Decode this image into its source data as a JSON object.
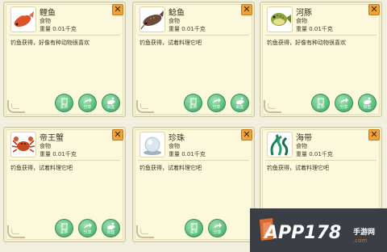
{
  "cards": [
    {
      "name": "鲤鱼",
      "type": "食物",
      "weight": "重量 0.01千克",
      "desc": "钓鱼获得，好像有种动物很喜欢",
      "icon": "carp-icon",
      "buttons": [
        "丢弃",
        "分享",
        "出售"
      ]
    },
    {
      "name": "鲶鱼",
      "type": "食物",
      "weight": "重量 0.01千克",
      "desc": "钓鱼获得，试着料理它吧",
      "icon": "catfish-icon",
      "buttons": [
        "丢弃",
        "分享",
        "出售"
      ]
    },
    {
      "name": "河豚",
      "type": "食物",
      "weight": "重量 0.01千克",
      "desc": "钓鱼获得，好像有种动物很喜欢",
      "icon": "pufferfish-icon",
      "buttons": [
        "丢弃",
        "分享",
        "出售"
      ]
    },
    {
      "name": "帝王蟹",
      "type": "食物",
      "weight": "重量 0.01千克",
      "desc": "钓鱼获得，试着料理它吧",
      "icon": "king-crab-icon",
      "buttons": [
        "丢弃",
        "分享",
        "出售"
      ]
    },
    {
      "name": "珍珠",
      "type": "食物",
      "weight": "重量 0.01千克",
      "desc": "钓鱼获得，试着料理它吧",
      "icon": "pearl-icon",
      "buttons": [
        "丢弃",
        "分享"
      ]
    },
    {
      "name": "海带",
      "type": "食物",
      "weight": "重量 0.01千克",
      "desc": "钓鱼获得，试着料理它吧",
      "icon": "kelp-icon",
      "buttons": []
    }
  ],
  "close_label": "✕",
  "watermark": {
    "main": "APP178",
    "sub": "手游网",
    "url": ".com"
  },
  "colors": {
    "card_bg": "#fbf8dc",
    "button_green": "#5cbf7e",
    "close_orange": "#f0a23a"
  }
}
